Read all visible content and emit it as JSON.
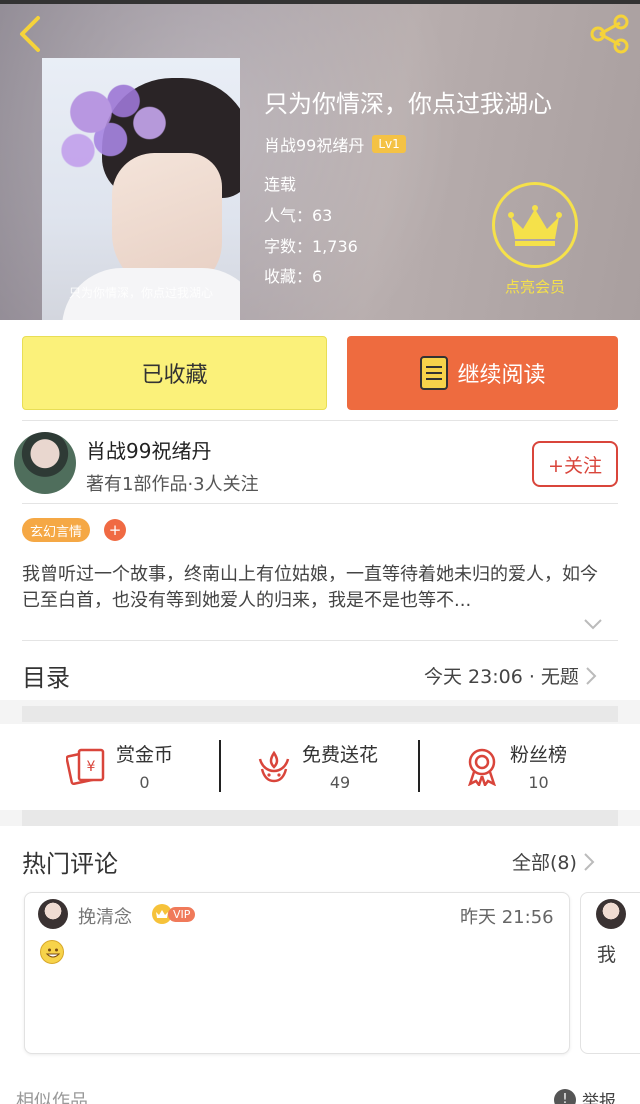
{
  "book": {
    "title": "只为你情深，你点过我湖心",
    "cover_caption": "只为你情深，你点过我湖心",
    "author": "肖战99祝绪丹",
    "level": "Lv1",
    "status": "连载",
    "popularity": "人气：63",
    "word_count": "字数：1,736",
    "favorites": "收藏：6"
  },
  "membership": {
    "label": "点亮会员"
  },
  "actions": {
    "collected_label": "已收藏",
    "continue_label": "继续阅读"
  },
  "author_info": {
    "name": "肖战99祝绪丹",
    "meta": "著有1部作品·3人关注",
    "follow_label": "+关注"
  },
  "tags": {
    "genre": "玄幻言情",
    "add": "+"
  },
  "synopsis": "我曾听过一个故事，终南山上有位姑娘，一直等待着她未归的爱人，如今已至白首，也没有等到她爱人的归来，我是不是也等不...",
  "toc": {
    "label": "目录",
    "latest": "今天 23:06 · 无题"
  },
  "features": [
    {
      "label": "赏金币",
      "value": "0"
    },
    {
      "label": "免费送花",
      "value": "49"
    },
    {
      "label": "粉丝榜",
      "value": "10"
    }
  ],
  "hot_comments": {
    "title": "热门评论",
    "all_label": "全部(8)",
    "items": [
      {
        "user": "挽清念",
        "badge": "VIP",
        "time": "昨天 21:56"
      },
      {
        "text": "我"
      }
    ]
  },
  "footer": {
    "similar": "相似作品",
    "report": "举报",
    "report_icon": "!"
  },
  "colors": {
    "accent_orange": "#ee6b3f",
    "collected_yellow": "#fbf17a",
    "crown_yellow": "#f5e14a",
    "follow_red": "#d9453b"
  }
}
